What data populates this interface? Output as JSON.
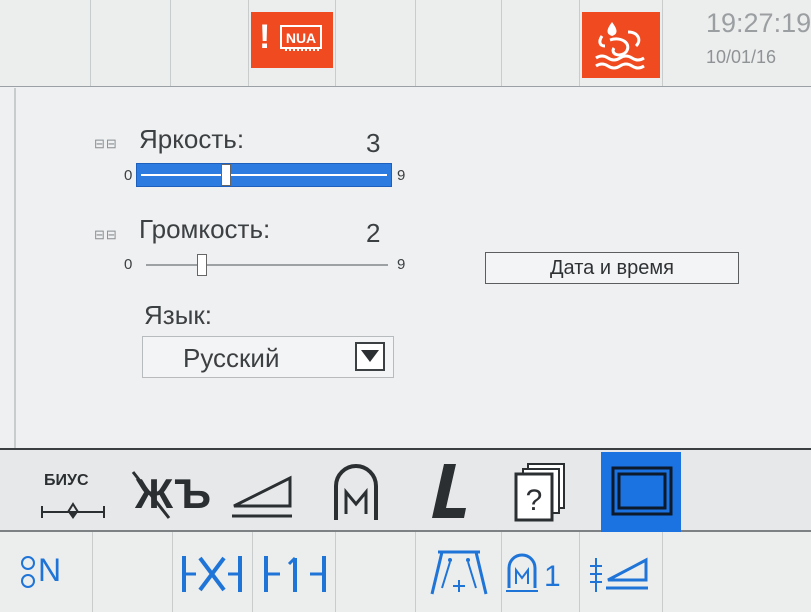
{
  "status_bar": {
    "alert_text": "!",
    "alert_icon": "nua-chip-icon",
    "heater_icon": "steam-heater-icon",
    "time": "19:27:19",
    "date": "10/01/16",
    "alert_color": "#f04a21"
  },
  "settings": {
    "brightness": {
      "label": "Яркость:",
      "value": "3",
      "min": "0",
      "max": "9",
      "level": 3
    },
    "volume": {
      "label": "Громкость:",
      "value": "2",
      "min": "0",
      "max": "9",
      "level": 2
    },
    "language": {
      "label": "Язык:",
      "value": "Русский"
    },
    "datetime_button": "Дата и время"
  },
  "toolbar": {
    "items": [
      {
        "name": "biys-tension-tool",
        "text": "БИУС"
      },
      {
        "name": "thread-settings-tool"
      },
      {
        "name": "presser-foot-tool"
      },
      {
        "name": "m-arch-tool"
      },
      {
        "name": "l-tool"
      },
      {
        "name": "help-tool"
      },
      {
        "name": "screen-settings-tool",
        "selected": true
      }
    ],
    "selected_color": "#1a73e0"
  },
  "bottom_bar": {
    "needle_text": "N",
    "m_counter": "1"
  }
}
